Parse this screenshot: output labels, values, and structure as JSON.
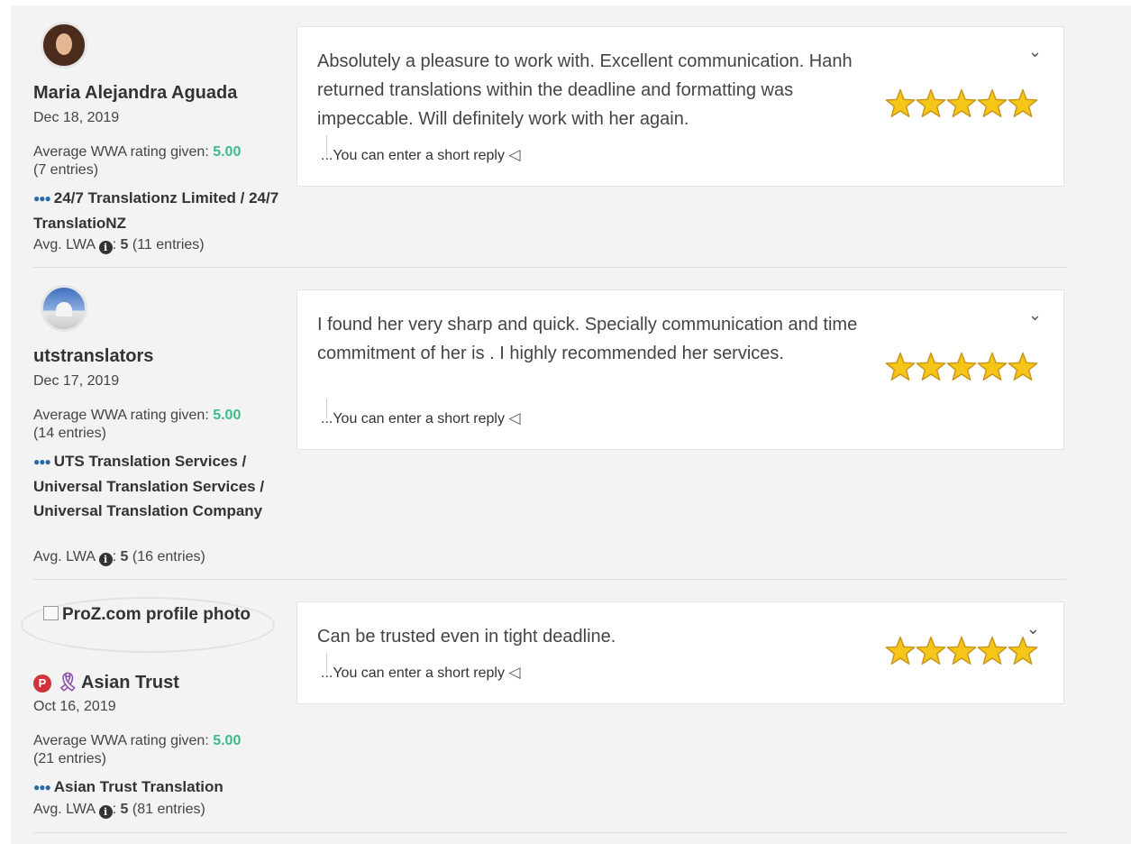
{
  "reviews": [
    {
      "name": "Maria Alejandra Aguada",
      "date": "Dec 18, 2019",
      "avg_label": "Average WWA rating given: ",
      "avg_value": "5.00",
      "avg_entries": "(7 entries)",
      "company": "24/7 Translationz Limited / 24/7 TranslatioNZ",
      "lwa_label": "Avg. LWA",
      "lwa_value": "5",
      "lwa_entries": "(11 entries)",
      "review_text": "Absolutely a pleasure to work with. Excellent communication. Hanh returned translations within the deadline and formatting was impeccable. Will definitely work with her again.",
      "reply_placeholder": "...You can enter a short reply",
      "rating": 5
    },
    {
      "name": "utstranslators",
      "date": "Dec 17, 2019",
      "avg_label": "Average WWA rating given: ",
      "avg_value": "5.00",
      "avg_entries": "(14 entries)",
      "company": "UTS Translation Services / Universal Translation Services / Universal Translation Company",
      "lwa_label": "Avg. LWA",
      "lwa_value": "5",
      "lwa_entries": "(16 entries)",
      "review_text": "I found her very sharp and quick. Specially communication and time commitment of her is . I highly recommended her services.",
      "reply_placeholder": "...You can enter a short reply",
      "rating": 5
    },
    {
      "broken_photo_alt": "ProZ.com profile photo",
      "name": "Asian Trust",
      "badge_letter": "P",
      "date": "Oct 16, 2019",
      "avg_label": "Average WWA rating given: ",
      "avg_value": "5.00",
      "avg_entries": "(21 entries)",
      "company": "Asian Trust Translation",
      "lwa_label": "Avg. LWA",
      "lwa_value": "5",
      "lwa_entries": "(81 entries)",
      "review_text": "Can be trusted even in tight deadline.",
      "reply_placeholder": "...You can enter a short reply",
      "rating": 5
    }
  ],
  "icons": {
    "chevron": "chevron-down-icon",
    "send": "paper-plane-icon",
    "team": "team-icon",
    "info": "info-icon",
    "star": "star-icon"
  },
  "colors": {
    "rating_value": "#3fba8a",
    "star_fill": "#f5c518",
    "star_stroke": "#c8941a",
    "badge": "#d0343a"
  }
}
